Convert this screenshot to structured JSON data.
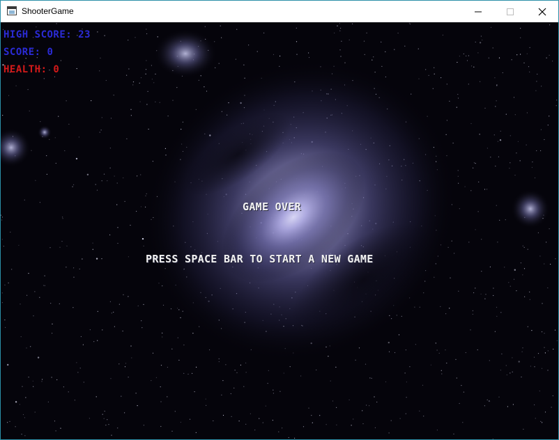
{
  "window": {
    "title": "ShooterGame",
    "icon": "app-window-icon",
    "controls": {
      "minimize": "minimize-icon",
      "maximize": "maximize-icon",
      "close": "close-icon"
    }
  },
  "hud": {
    "high_score": "HIGH SCORE: 23",
    "score": "SCORE: 0",
    "health": "HEALTH: 0"
  },
  "messages": {
    "game_over": "GAME OVER",
    "prompt": "PRESS SPACE BAR TO START A NEW GAME"
  },
  "colors": {
    "hud_score": "#2b2bd6",
    "hud_health": "#d41a1a",
    "message": "#f2f2f2",
    "space": "#05040b",
    "galaxy": "#8a86c8"
  }
}
